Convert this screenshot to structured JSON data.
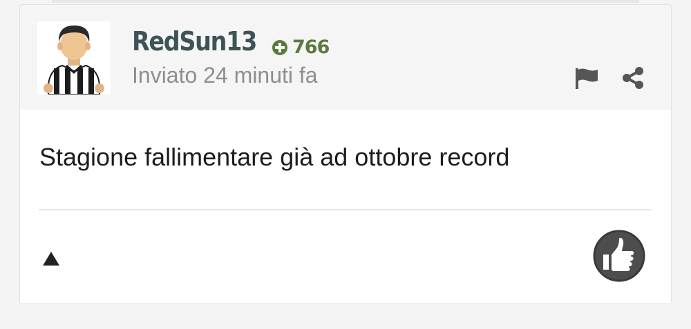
{
  "post": {
    "username": "RedSun13",
    "points": "766",
    "timestamp": "Inviato 24 minuti fa",
    "body": "Stagione fallimentare già ad ottobre record"
  },
  "icons": {
    "avatar": "footballer-avatar-black-white-jersey",
    "points": "plus-circle-icon",
    "flag": "flag-icon",
    "share": "share-icon",
    "expand": "triangle-up-icon",
    "like": "thumbs-up-icon"
  },
  "colors": {
    "username": "#3e5356",
    "points": "#5a7a3e",
    "timestamp": "#8e8e8e",
    "header_bg": "#f5f5f5",
    "like_circle": "#4d4d4d"
  }
}
